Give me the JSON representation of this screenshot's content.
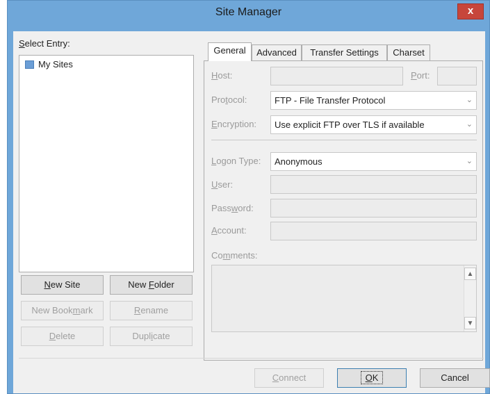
{
  "window": {
    "title": "Site Manager",
    "close_glyph": "x"
  },
  "left": {
    "select_entry_label": "Select Entry:",
    "tree": [
      {
        "label": "My Sites",
        "icon": "folder-icon"
      }
    ],
    "buttons": {
      "new_site": "New Site",
      "new_folder": "New Folder",
      "new_bookmark": "New Bookmark",
      "rename": "Rename",
      "delete": "Delete",
      "duplicate": "Duplicate"
    }
  },
  "tabs": [
    "General",
    "Advanced",
    "Transfer Settings",
    "Charset"
  ],
  "general": {
    "host_label": "Host:",
    "host_value": "",
    "port_label": "Port:",
    "port_value": "",
    "protocol_label": "Protocol:",
    "protocol_value": "FTP - File Transfer Protocol",
    "encryption_label": "Encryption:",
    "encryption_value": "Use explicit FTP over TLS if available",
    "logon_type_label": "Logon Type:",
    "logon_type_value": "Anonymous",
    "user_label": "User:",
    "password_label": "Password:",
    "account_label": "Account:",
    "comments_label": "Comments:"
  },
  "footer": {
    "connect": "Connect",
    "ok": "OK",
    "cancel": "Cancel"
  },
  "colors": {
    "titlebar": "#6fa7d9",
    "close": "#c7463b",
    "dialog": "#f0f0f0"
  }
}
